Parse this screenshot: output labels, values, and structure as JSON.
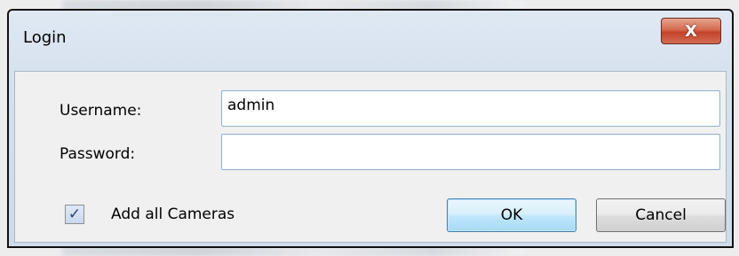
{
  "window": {
    "title": "Login",
    "close_glyph": "X"
  },
  "form": {
    "username_label": "Username:",
    "username_value": "admin",
    "password_label": "Password:",
    "password_value": "",
    "add_all_cameras_label": "Add all Cameras",
    "add_all_cameras_checked": true,
    "checkbox_glyph": "✓"
  },
  "buttons": {
    "ok_label": "OK",
    "cancel_label": "Cancel"
  },
  "icons": {
    "close": "close-icon",
    "checkbox": "check-icon"
  }
}
